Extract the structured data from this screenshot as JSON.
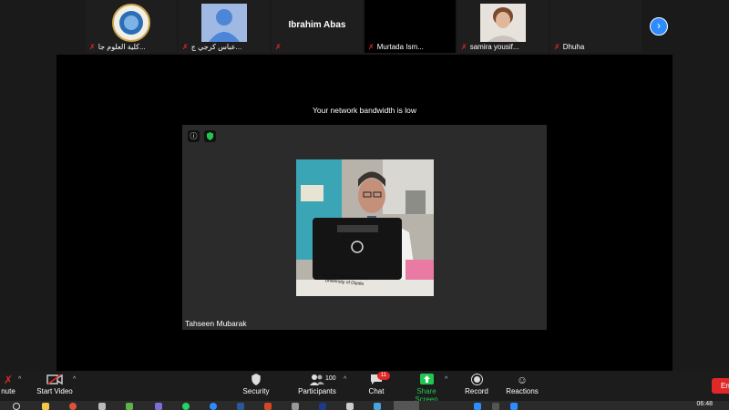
{
  "participants": [
    {
      "name": "كلية العلوم جا...",
      "type": "logo"
    },
    {
      "name": "عباس كرجي ج...",
      "type": "avatar"
    },
    {
      "name": "",
      "display_name": "Ibrahim Abas",
      "type": "name"
    },
    {
      "name": "Murtada Ism...",
      "type": "black"
    },
    {
      "name": "samira yousif...",
      "type": "photo"
    },
    {
      "name": "Dhuha",
      "type": "blank"
    }
  ],
  "notice": "Your network bandwidth is low",
  "speaker": {
    "name": "Tahseen Mubarak",
    "placard_line1": "Dr. Tahseen Mubarak",
    "placard_line2": "University of Diyala"
  },
  "toolbar": {
    "mute_label": "nute",
    "video_label": "Start Video",
    "security_label": "Security",
    "participants_label": "Participants",
    "participants_count": "100",
    "chat_label": "Chat",
    "chat_badge": "11",
    "share_label": "Share Screen",
    "record_label": "Record",
    "reactions_label": "Reactions",
    "end_label": "En"
  },
  "taskbar": {
    "time": "06:48"
  },
  "colors": {
    "accent": "#2d8cff",
    "share": "#23c552",
    "danger": "#e02828"
  }
}
